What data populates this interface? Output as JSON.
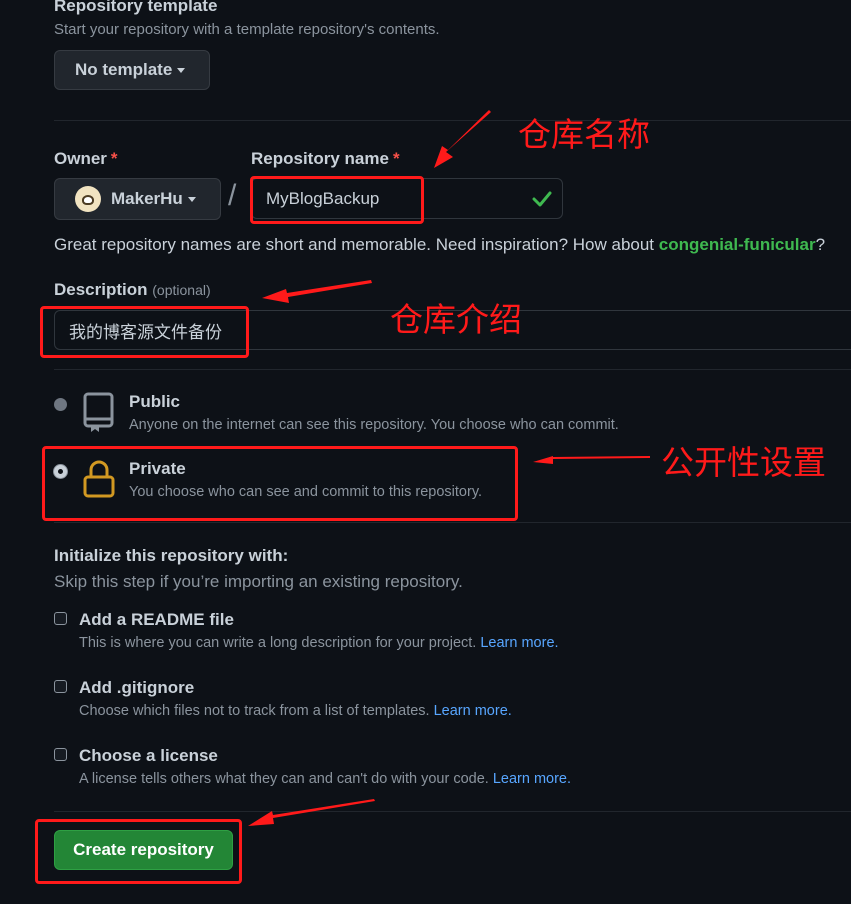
{
  "template": {
    "label": "Repository template",
    "description": "Start your repository with a template repository's contents.",
    "button": "No template"
  },
  "owner": {
    "label": "Owner",
    "required_mark": "*",
    "name": "MakerHu"
  },
  "slash": "/",
  "repo_name": {
    "label": "Repository name",
    "required_mark": "*",
    "value": "MyBlogBackup"
  },
  "hint": {
    "text": "Great repository names are short and memorable. Need inspiration? How about ",
    "suggestion": "congenial-funicular",
    "end": "?"
  },
  "description": {
    "label": "Description",
    "optional": "(optional)",
    "value": "我的博客源文件备份"
  },
  "visibility": {
    "public_title": "Public",
    "public_desc": "Anyone on the internet can see this repository. You choose who can commit.",
    "private_title": "Private",
    "private_desc": "You choose who can see and commit to this repository.",
    "selected": "private"
  },
  "init": {
    "title": "Initialize this repository with:",
    "subtitle": "Skip this step if you’re importing an existing repository.",
    "readme_title": "Add a README file",
    "readme_desc": "This is where you can write a long description for your project.",
    "gitignore_title": "Add .gitignore",
    "gitignore_desc": "Choose which files not to track from a list of templates.",
    "license_title": "Choose a license",
    "license_desc": "A license tells others what they can and can't do with your code.",
    "learn_more": "Learn more."
  },
  "create_button": "Create repository",
  "annotations": {
    "repo_name": "仓库名称",
    "description": "仓库介绍",
    "visibility": "公开性设置"
  },
  "colors": {
    "background": "#0d1117",
    "accent_green": "#238636",
    "link": "#58a6ff",
    "annotation_red": "#ff1a1a",
    "lock_yellow": "#d29922"
  }
}
